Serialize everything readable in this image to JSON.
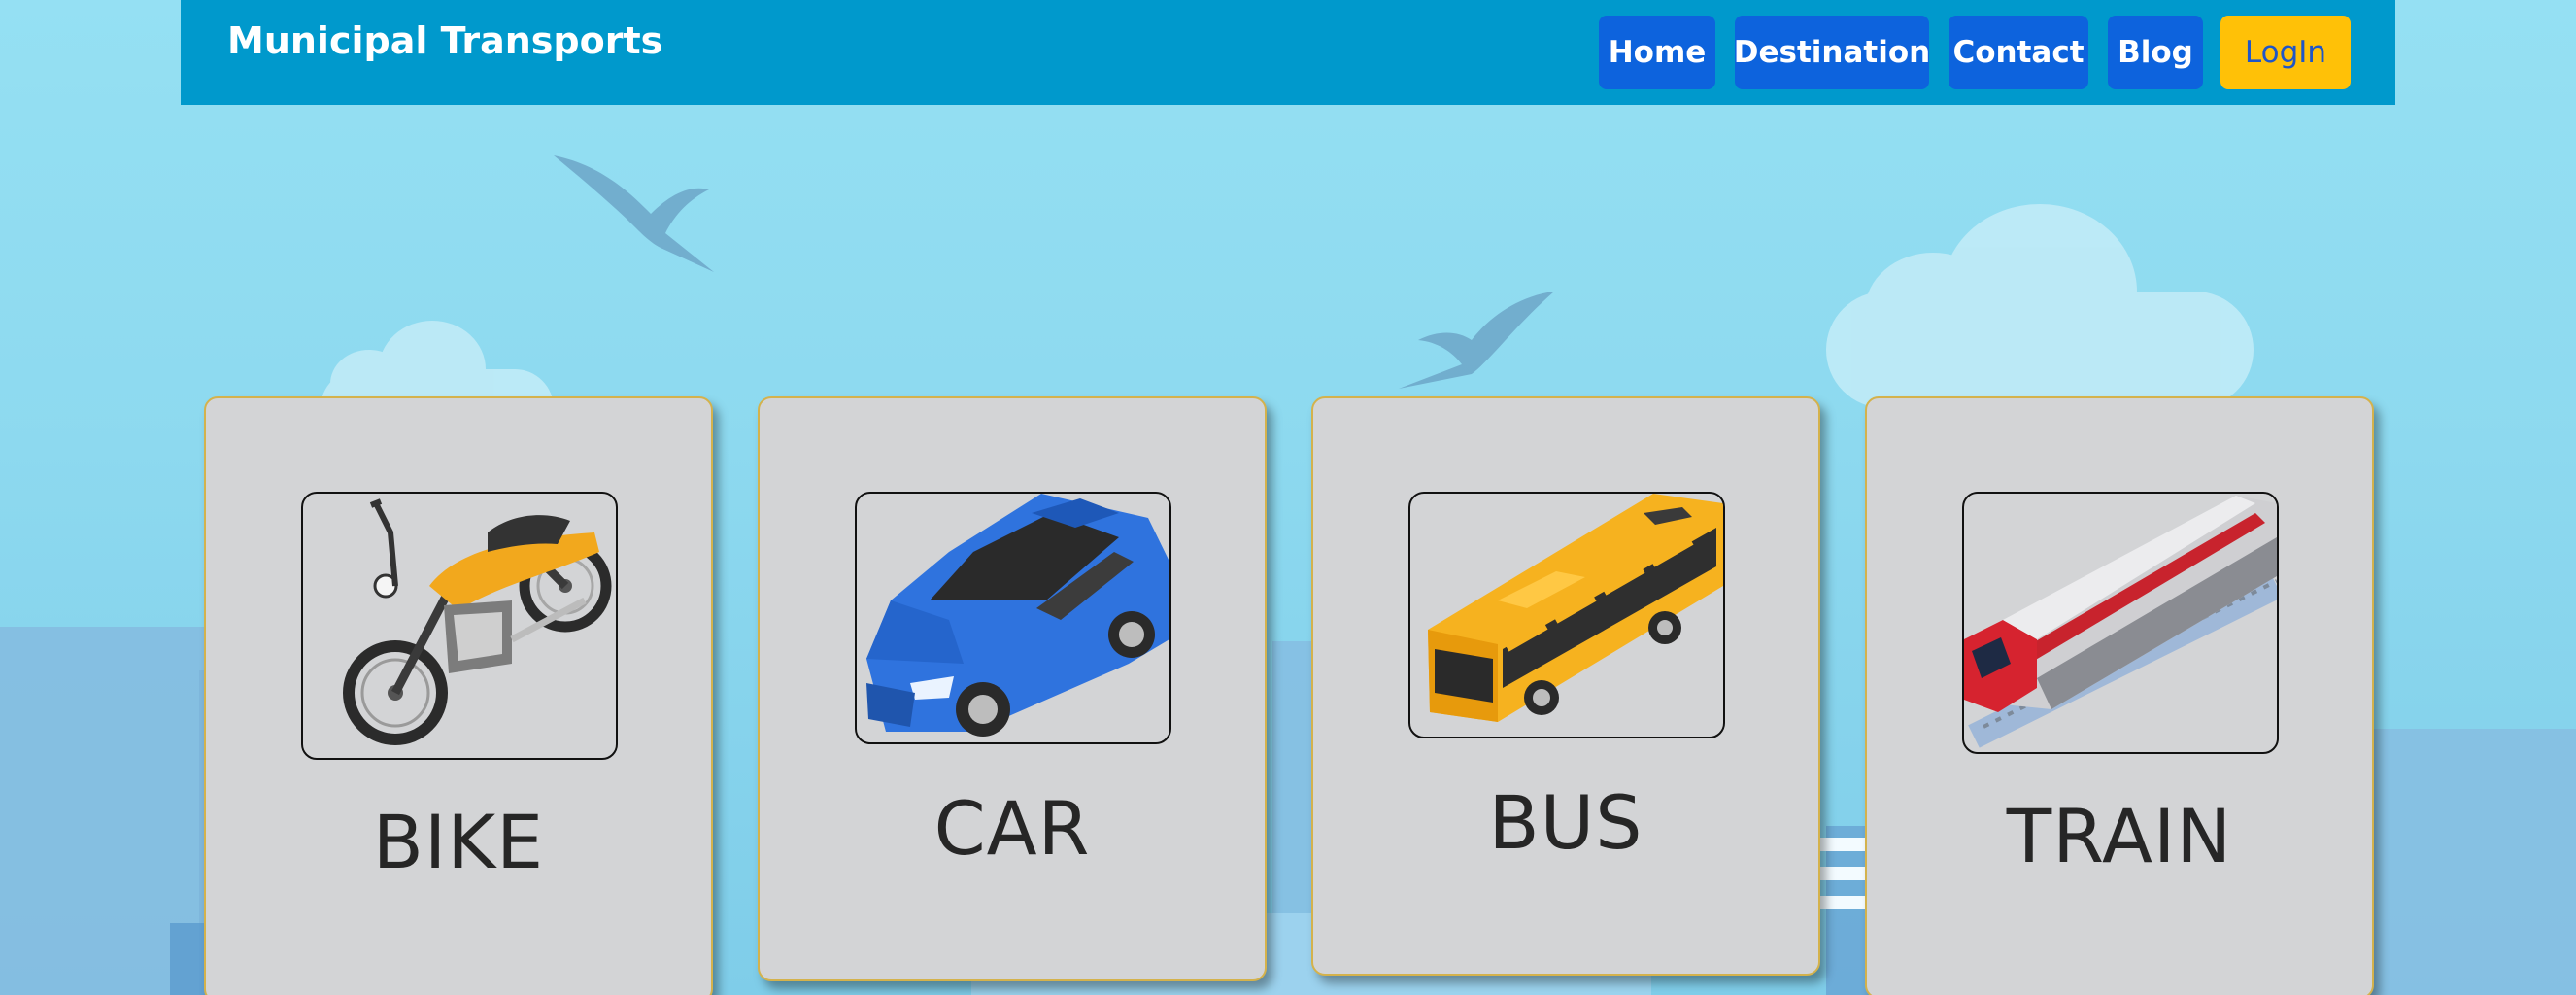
{
  "navbar": {
    "brand": "Municipal Transports",
    "links": [
      {
        "label": "Home"
      },
      {
        "label": "Destination"
      },
      {
        "label": "Contact"
      },
      {
        "label": "Blog"
      }
    ],
    "login_label": "LogIn"
  },
  "cards": [
    {
      "title": "BIKE",
      "icon": "motorbike-icon"
    },
    {
      "title": "CAR",
      "icon": "car-icon"
    },
    {
      "title": "BUS",
      "icon": "bus-icon"
    },
    {
      "title": "TRAIN",
      "icon": "train-icon"
    }
  ],
  "colors": {
    "navbar_bg": "#0099cc",
    "nav_button_bg": "#0d63dd",
    "login_button_bg": "#ffc107",
    "sky": "#95e0f3",
    "card_bg": "#d3d4d6",
    "card_border": "#d4b24c"
  }
}
